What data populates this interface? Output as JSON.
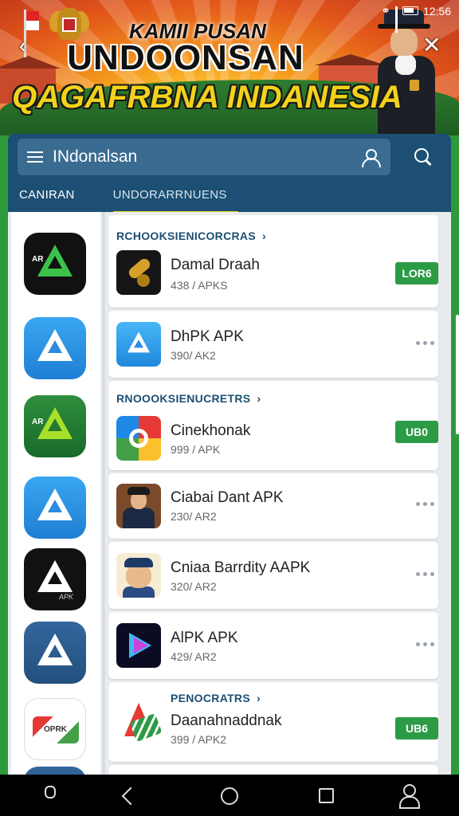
{
  "status_bar": {
    "time": "12:56"
  },
  "banner": {
    "line1": "KAMII PUSAN",
    "line2": "UNDOONSAN",
    "line3": "QAGAFRBNA INDANESIA"
  },
  "search": {
    "value": "INdonalsan"
  },
  "tabs": [
    {
      "label": "CANIRAN"
    },
    {
      "label": "UNDORARRNUENS"
    }
  ],
  "sections": [
    {
      "title": "RCHOOKSIENICORCRAS"
    },
    {
      "title": "RNOOOKSIENUCRETRS"
    },
    {
      "title": "PENOCRATRS"
    }
  ],
  "apps": [
    {
      "name": "Damal Draah",
      "sub": "438 / APKS",
      "action": "LOR6"
    },
    {
      "name": "DhPK APK",
      "sub": "390/ AK2",
      "action": ""
    },
    {
      "name": "Cinekhonak",
      "sub": "999 / APK",
      "action": "UB0"
    },
    {
      "name": "Ciabai Dant APK",
      "sub": "230/ AR2",
      "action": ""
    },
    {
      "name": "Cniaa Barrdity AAPK",
      "sub": "320/ AR2",
      "action": ""
    },
    {
      "name": "AlPK APK",
      "sub": "429/ AR2",
      "action": ""
    },
    {
      "name": "Daanahnaddnak",
      "sub": "399 / APK2",
      "action": "UB6"
    }
  ],
  "sidebar_icons": [
    {
      "icon": "apk-logo-dark-icon",
      "text": "AR"
    },
    {
      "icon": "apk-logo-blue-icon",
      "text": ""
    },
    {
      "icon": "apk-logo-green-icon",
      "text": "AR"
    },
    {
      "icon": "apk-logo-blue-icon",
      "text": ""
    },
    {
      "icon": "apk-logo-dark-icon",
      "text": "APK"
    },
    {
      "icon": "apk-logo-navy-icon",
      "text": ""
    },
    {
      "icon": "opk-logo-icon",
      "text": "OPRK"
    }
  ],
  "colors": {
    "appbar": "#1c4f73",
    "accent": "#f2d21a",
    "action_button": "#2c9b46",
    "background": "#2f9a3c"
  }
}
